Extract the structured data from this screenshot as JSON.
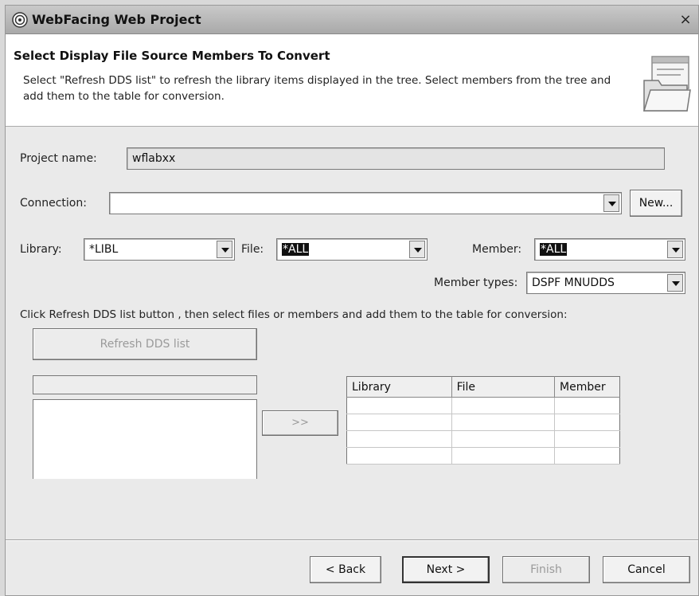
{
  "window": {
    "title": "WebFacing Web Project",
    "close_glyph": "×"
  },
  "banner": {
    "title": "Select Display File Source Members To Convert",
    "description": "Select \"Refresh DDS list\" to refresh the library items displayed in the tree. Select members from the tree and add them to the table for conversion."
  },
  "project": {
    "label": "Project name:",
    "value": "wflabxx"
  },
  "connection": {
    "label": "Connection:",
    "value": "",
    "new_button": "New..."
  },
  "library": {
    "label": "Library:",
    "value": "*LIBL"
  },
  "file": {
    "label": "File:",
    "value": "*ALL"
  },
  "member": {
    "label": "Member:",
    "value": "*ALL"
  },
  "member_types": {
    "label": "Member types:",
    "value": "DSPF MNUDDS"
  },
  "instructions": "Click Refresh DDS list button , then select files or members and add them to the table for conversion:",
  "refresh_button": "Refresh DDS list",
  "add_button": ">>",
  "table": {
    "columns": [
      "Library",
      "File",
      "Member"
    ]
  },
  "footer": {
    "back": "< Back",
    "next": "Next >",
    "finish": "Finish",
    "cancel": "Cancel"
  }
}
